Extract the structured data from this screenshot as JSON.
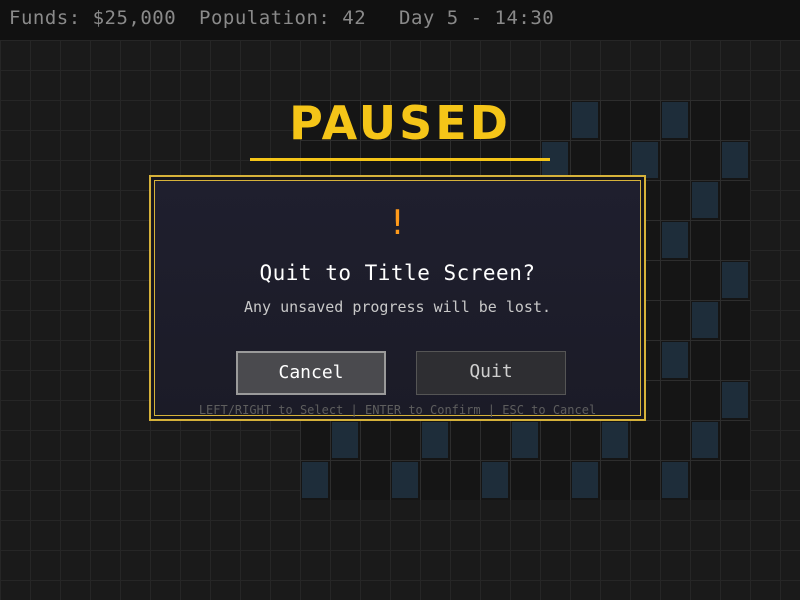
{
  "hud": {
    "funds": "Funds: $25,000",
    "population": "Population: 42",
    "time": "Day 5 - 14:30"
  },
  "pause_title": "PAUSED",
  "dialog": {
    "icon": "warning-icon",
    "icon_glyph": "!",
    "title": "Quit to Title Screen?",
    "message": "Any unsaved progress will be lost.",
    "cancel_label": "Cancel",
    "quit_label": "Quit",
    "selected_button": "Cancel",
    "hint": "LEFT/RIGHT to Select | ENTER to Confirm | ESC to Cancel"
  },
  "colors": {
    "accent": "#f5c518",
    "warning": "#ff9a1a",
    "dialog_border": "#d6b23a",
    "building": "#1e2d3a"
  }
}
